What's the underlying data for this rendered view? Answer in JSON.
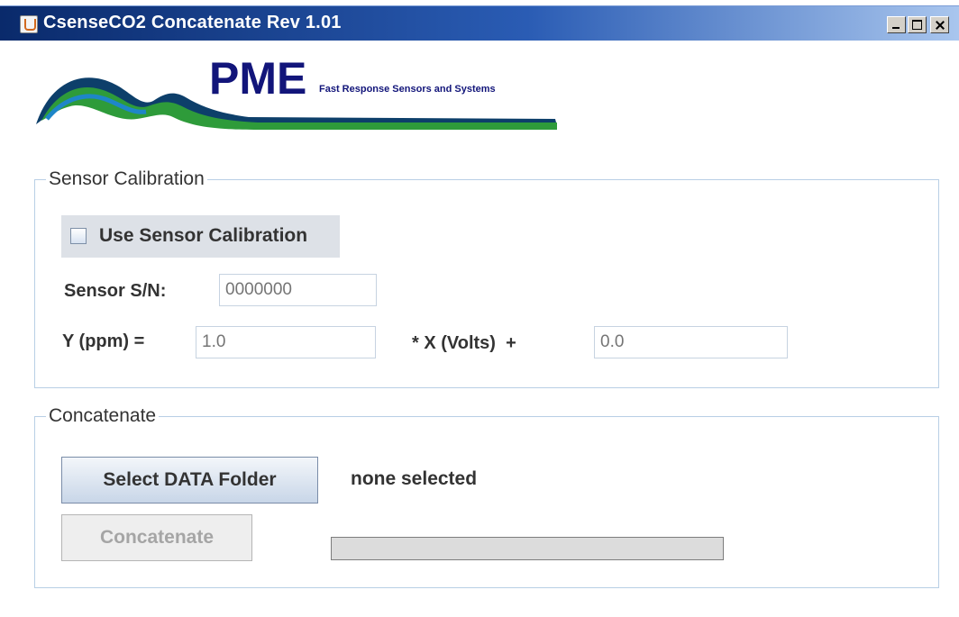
{
  "window": {
    "title": "CsenseCO2 Concatenate Rev 1.01"
  },
  "logo": {
    "brand": "PME",
    "tagline": "Fast Response Sensors and Systems",
    "colors": {
      "text": "#12157a",
      "wave_dark": "#0d3f6a",
      "wave_green": "#2e9b3a",
      "wave_blue": "#1e86c8"
    }
  },
  "calibration": {
    "legend": "Sensor Calibration",
    "use_label": "Use Sensor Calibration",
    "use_checked": false,
    "sn_label": "Sensor S/N:",
    "sn_placeholder": "0000000",
    "y_label": "Y (ppm) =",
    "slope_placeholder": "1.0",
    "x_label": "* X (Volts)  +",
    "offset_placeholder": "0.0"
  },
  "concatenate": {
    "legend": "Concatenate",
    "select_label": "Select DATA Folder",
    "folder_status": "none selected",
    "concat_label": "Concatenate",
    "progress": 0
  }
}
